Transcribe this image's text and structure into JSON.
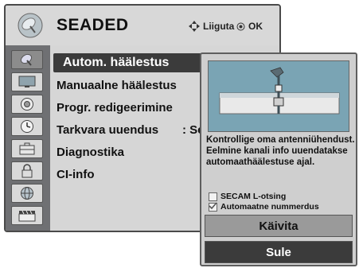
{
  "header": {
    "title": "SEADED",
    "hint_move": "Liiguta",
    "hint_ok": "OK",
    "icon": "satellite-dish-icon"
  },
  "sidebar": {
    "icons": [
      "satellite-icon",
      "monitor-icon",
      "speaker-icon",
      "clock-icon",
      "toolbox-icon",
      "lock-icon",
      "globe-icon",
      "clapper-icon"
    ]
  },
  "menu": {
    "items": [
      {
        "label": "Autom. häälestus",
        "selected": true
      },
      {
        "label": "Manuaalne häälestus"
      },
      {
        "label": "Progr. redigeerimine"
      },
      {
        "label": "Tarkvara uuendus",
        "value": ": Se"
      },
      {
        "label": "Diagnostika"
      },
      {
        "label": "CI-info"
      }
    ]
  },
  "popup": {
    "message": "Kontrollige oma antenniühendust. Eelmine kanali info uuendatakse automaathäälestuse ajal.",
    "options": [
      {
        "label": "SECAM L-otsing",
        "checked": false
      },
      {
        "label": "Automaatne nummerdus",
        "checked": true
      }
    ],
    "start_label": "Käivita",
    "close_label": "Sule"
  },
  "colors": {
    "selected_bg": "#3b3b3b",
    "panel_bg": "#d6d6d6",
    "sidebar_bg": "#6f7073"
  }
}
